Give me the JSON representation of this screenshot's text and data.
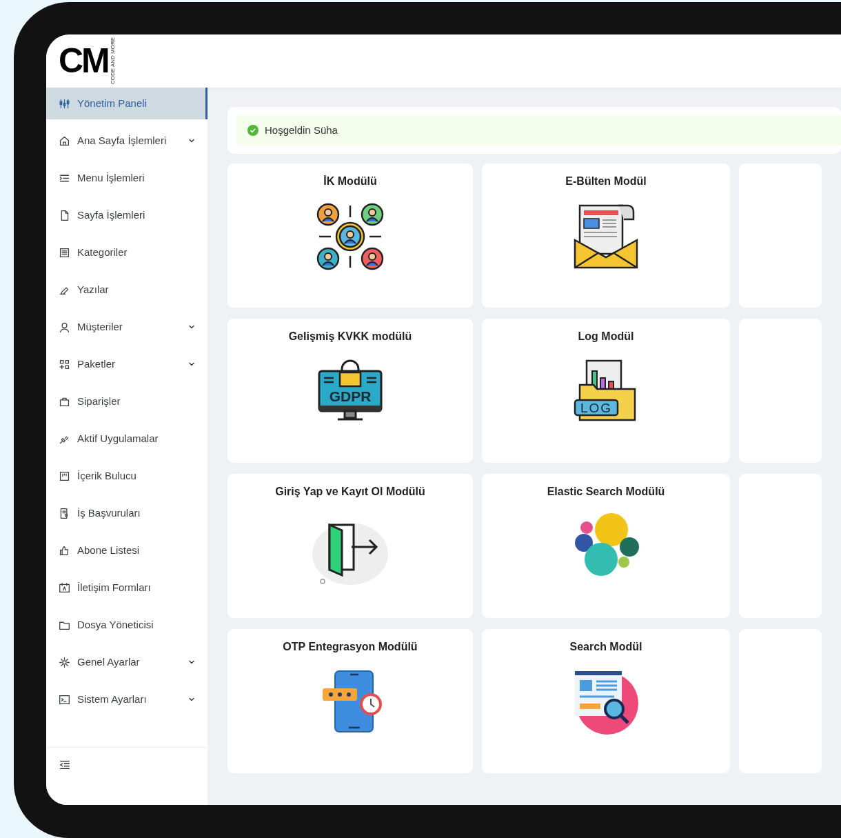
{
  "logo": {
    "text": "CM",
    "tagline": "CODE AND MORE"
  },
  "sidebar": {
    "items": [
      {
        "label": "Yönetim Paneli",
        "kind": "link",
        "selected": true
      },
      {
        "label": "Ana Sayfa İşlemleri",
        "kind": "group",
        "selected": false
      },
      {
        "label": "Menu İşlemleri",
        "kind": "link",
        "selected": false
      },
      {
        "label": "Sayfa İşlemleri",
        "kind": "link",
        "selected": false
      },
      {
        "label": "Kategoriler",
        "kind": "link",
        "selected": false
      },
      {
        "label": "Yazılar",
        "kind": "link",
        "selected": false
      },
      {
        "label": "Müşteriler",
        "kind": "group",
        "selected": false
      },
      {
        "label": "Paketler",
        "kind": "group",
        "selected": false
      },
      {
        "label": "Siparişler",
        "kind": "link",
        "selected": false
      },
      {
        "label": "Aktif Uygulamalar",
        "kind": "link",
        "selected": false
      },
      {
        "label": "İçerik Bulucu",
        "kind": "link",
        "selected": false
      },
      {
        "label": "İş Başvuruları",
        "kind": "link",
        "selected": false
      },
      {
        "label": "Abone Listesi",
        "kind": "link",
        "selected": false
      },
      {
        "label": "İletişim Formları",
        "kind": "link",
        "selected": false
      },
      {
        "label": "Dosya Yöneticisi",
        "kind": "link",
        "selected": false
      },
      {
        "label": "Genel Ayarlar",
        "kind": "group",
        "selected": false
      },
      {
        "label": "Sistem Ayarları",
        "kind": "group",
        "selected": false
      }
    ]
  },
  "welcome": {
    "text": "Hoşgeldin Süha"
  },
  "modules": [
    {
      "kind": "module",
      "title": "İK Modülü"
    },
    {
      "kind": "module",
      "title": "E-Bülten Modül"
    },
    {
      "kind": "cut_off"
    },
    {
      "kind": "module",
      "title": "Gelişmiş KVKK modülü",
      "icon_text": "GDPR"
    },
    {
      "kind": "module",
      "title": "Log Modül",
      "icon_text": "LOG"
    },
    {
      "kind": "cut_off"
    },
    {
      "kind": "module",
      "title": "Giriş Yap ve Kayıt Ol Modülü"
    },
    {
      "kind": "module",
      "title": "Elastic Search Modülü"
    },
    {
      "kind": "cut_off"
    },
    {
      "kind": "module",
      "title": "OTP Entegrasyon Modülü"
    },
    {
      "kind": "module",
      "title": "Search Modül"
    },
    {
      "kind": "cut_off"
    }
  ]
}
